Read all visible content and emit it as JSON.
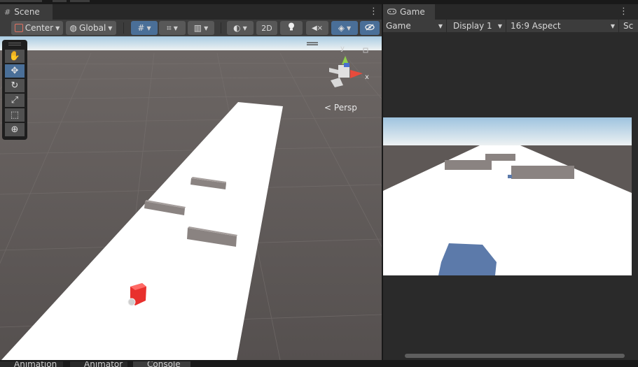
{
  "scene_tab": {
    "title": "Scene",
    "icon": "hash-icon"
  },
  "game_tab": {
    "title": "Game",
    "icon": "gamepad-icon"
  },
  "scene_toolbar": {
    "pivot_label": "Center",
    "space_label": "Global",
    "mode_2d_label": "2D"
  },
  "game_toolbar": {
    "mode_label": "Game",
    "display_label": "Display 1",
    "aspect_label": "16:9 Aspect",
    "scale_label": "Sc"
  },
  "scene_view": {
    "projection_label": "Persp",
    "axis_y_label": "y",
    "axis_x_label": "x"
  },
  "bottom_tabs": [
    "Animation",
    "Animator",
    "Console"
  ],
  "colors": {
    "panel": "#3c3c3c",
    "accent": "#4a6f98",
    "ground": "#5a5553",
    "track": "#ffffff",
    "obstacle": "#8a8381",
    "player_scene": "#e8302d",
    "player_game": "#5c7aaa"
  }
}
